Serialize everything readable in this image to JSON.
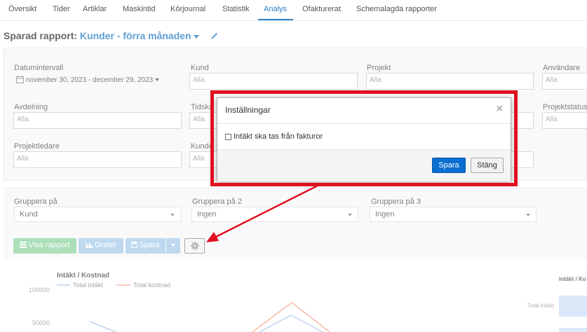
{
  "nav": {
    "tabs": [
      {
        "label": "Översikt"
      },
      {
        "label": "Tider"
      },
      {
        "label": "Artiklar"
      },
      {
        "label": "Maskintid"
      },
      {
        "label": "Körjournal"
      },
      {
        "label": "Statistik"
      },
      {
        "label": "Analys",
        "active": true
      },
      {
        "label": "Ofakturerat"
      },
      {
        "label": "Schemalagda rapporter"
      }
    ]
  },
  "report": {
    "prefix": "Sparad rapport:",
    "name": "Kunder - förra månaden"
  },
  "filters": {
    "date_label": "Datumintervall",
    "date_value": "november 30, 2023 - december 29, 2023",
    "kund_label": "Kund",
    "projekt_label": "Projekt",
    "anvandare_label": "Användare",
    "avdelning_label": "Avdelning",
    "tidska_label": "Tidska",
    "projektstatus_label": "Projektstatus",
    "projektledare_label": "Projektledare",
    "kunde_label": "Kunde",
    "placeholder": "Alla"
  },
  "grouping": {
    "g1_label": "Gruppera på",
    "g1_value": "Kund",
    "g2_label": "Gruppera på 2",
    "g2_value": "Ingen",
    "g3_label": "Gruppera på 3",
    "g3_value": "Ingen"
  },
  "actions": {
    "show_report": "Visa rapport",
    "graph": "Grafer",
    "save": "Spara"
  },
  "modal": {
    "title": "Inställningar",
    "checkbox_label": "Intäkt ska tas från fakturor",
    "checkbox_checked": false,
    "save": "Spara",
    "close": "Stäng"
  },
  "chart_data": {
    "type": "line",
    "title": "Intäkt / Kostnad",
    "yticks": [
      "100000",
      "50000"
    ],
    "series": [
      {
        "name": "Total intäkt",
        "color": "#a9c4ec"
      },
      {
        "name": "Total kostnad",
        "color": "#f4a38c"
      }
    ]
  },
  "side_chart": {
    "title": "Intäkt / Ko",
    "category": "Total intäkt"
  },
  "colors": {
    "accent": "#2a7fc4",
    "annotation": "#e01020",
    "primary_button": "#0a6fd0",
    "show_report_button": "#8fd4a0",
    "graph_button": "#a9cdea"
  }
}
